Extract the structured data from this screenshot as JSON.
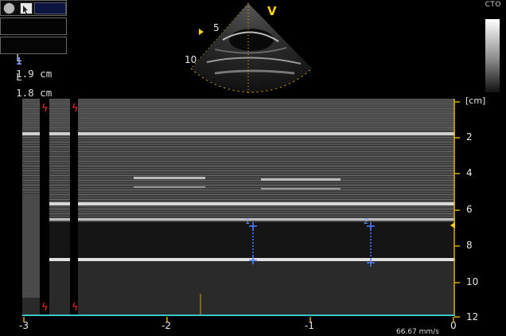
{
  "toolbar": {
    "tools": [
      "record-icon",
      "cursor-select-icon"
    ]
  },
  "measurements": [
    {
      "index": "2",
      "type": "L",
      "value": "1.9 cm",
      "color": "#7CFC6A"
    },
    {
      "index": "1",
      "type": "L",
      "value": "1.8 cm",
      "color": "#7A9CFF"
    }
  ],
  "header": {
    "cto": "CTO",
    "view_marker": "V"
  },
  "sector": {
    "depth_labels": [
      "5",
      "10"
    ]
  },
  "mmode": {
    "depth_unit": "[cm]",
    "depth_labels": [
      "2",
      "4",
      "6",
      "8",
      "10",
      "12"
    ],
    "time_labels": [
      "-3",
      "-2",
      "-1",
      "0"
    ],
    "sweep_speed": "66.67 mm/s",
    "markers": [
      "1",
      "2"
    ],
    "colors": {
      "axis": "#d6a800",
      "baseline": "#39c6c6",
      "caliper": "#4f7fff",
      "ecg_marker": "#ff2a2a"
    }
  }
}
